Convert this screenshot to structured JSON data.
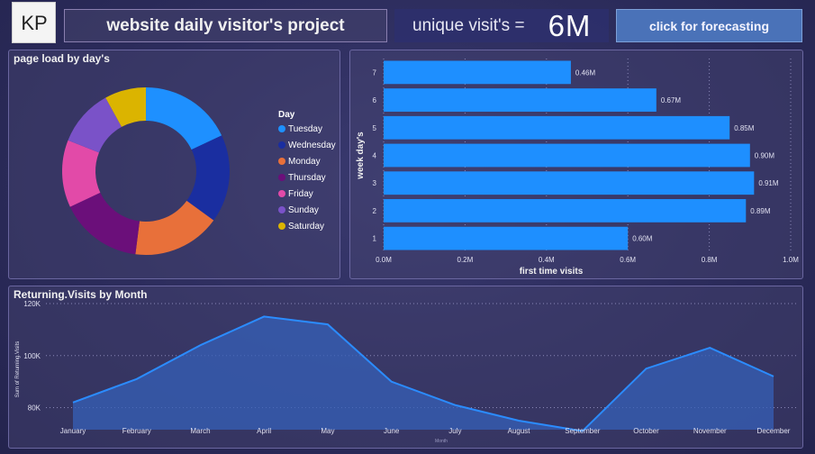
{
  "header": {
    "title": "website daily visitor's project",
    "kpi_label": "unique visit's =",
    "kpi_value": "6M",
    "forecast_button": "click for forecasting",
    "logo_text": "KP"
  },
  "colors": {
    "bar": "#1e8fff",
    "area_fill": "#3560b8",
    "area_line": "#2b8cff"
  },
  "chart_data": [
    {
      "type": "pie",
      "title": "page load by day's",
      "legend_title": "Day",
      "legend_position": "right",
      "categories": [
        "Tuesday",
        "Wednesday",
        "Monday",
        "Thursday",
        "Friday",
        "Sunday",
        "Saturday"
      ],
      "values": [
        18,
        17,
        17,
        16,
        13,
        11,
        8
      ],
      "colors": [
        "#1e90ff",
        "#1a2ea0",
        "#e8703a",
        "#6b0f7a",
        "#e24aa8",
        "#7a52c8",
        "#dbb400"
      ]
    },
    {
      "type": "bar",
      "orientation": "horizontal",
      "categories": [
        "1",
        "2",
        "3",
        "4",
        "5",
        "6",
        "7"
      ],
      "values": [
        0.6,
        0.89,
        0.91,
        0.9,
        0.85,
        0.67,
        0.46
      ],
      "value_labels": [
        "0.60M",
        "0.89M",
        "0.91M",
        "0.90M",
        "0.85M",
        "0.67M",
        "0.46M"
      ],
      "xlabel": "first time visits",
      "ylabel": "week day's",
      "xlim": [
        0,
        1.0
      ],
      "x_ticks": [
        "0.0M",
        "0.2M",
        "0.4M",
        "0.6M",
        "0.8M",
        "1.0M"
      ],
      "grid": true
    },
    {
      "type": "area",
      "title": "Returning.Visits by Month",
      "categories": [
        "January",
        "February",
        "March",
        "April",
        "May",
        "June",
        "July",
        "August",
        "September",
        "October",
        "November",
        "December"
      ],
      "values": [
        82,
        91,
        104,
        115,
        112,
        90,
        81,
        75,
        71,
        95,
        103,
        92
      ],
      "ylabel": "Sum of Returning.Visits",
      "xlabel": "Month",
      "ylim": [
        75,
        120
      ],
      "y_ticks": [
        "80K",
        "100K",
        "120K"
      ],
      "grid": true
    }
  ]
}
